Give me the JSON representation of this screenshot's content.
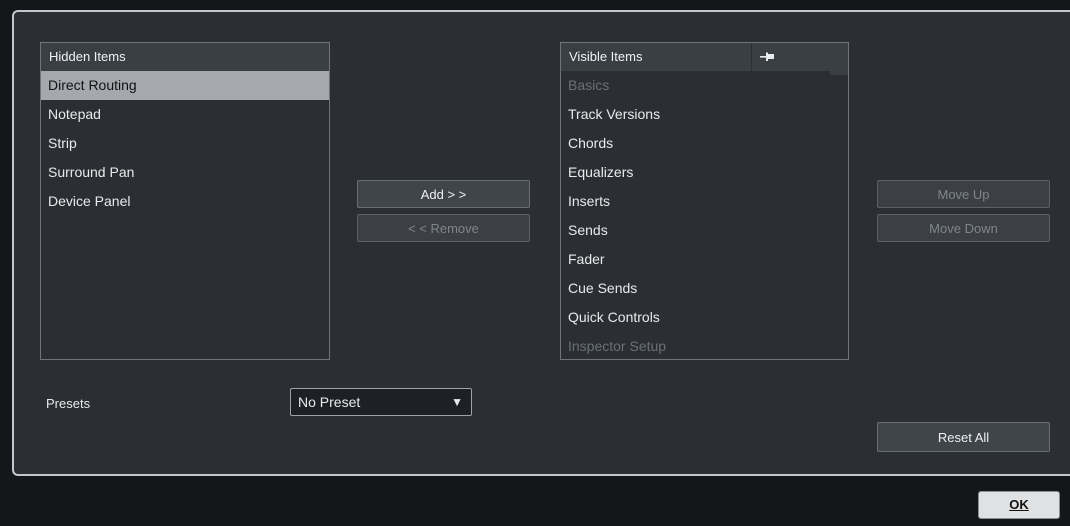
{
  "hidden_list": {
    "header": "Hidden Items",
    "items": [
      {
        "label": "Direct Routing",
        "selected": true
      },
      {
        "label": "Notepad"
      },
      {
        "label": "Strip"
      },
      {
        "label": "Surround Pan"
      },
      {
        "label": "Device Panel"
      }
    ]
  },
  "visible_list": {
    "header": "Visible Items",
    "pin_icon": "pin-icon",
    "items": [
      {
        "label": "Basics",
        "disabled": true
      },
      {
        "label": "Track Versions"
      },
      {
        "label": "Chords"
      },
      {
        "label": "Equalizers"
      },
      {
        "label": "Inserts"
      },
      {
        "label": "Sends"
      },
      {
        "label": "Fader"
      },
      {
        "label": "Cue Sends"
      },
      {
        "label": "Quick Controls"
      },
      {
        "label": "Inspector Setup",
        "disabled": true
      }
    ]
  },
  "buttons": {
    "add": "Add > >",
    "remove": "< < Remove",
    "move_up": "Move Up",
    "move_down": "Move Down",
    "reset_all": "Reset All",
    "ok": "OK"
  },
  "presets": {
    "label": "Presets",
    "selected": "No Preset"
  }
}
